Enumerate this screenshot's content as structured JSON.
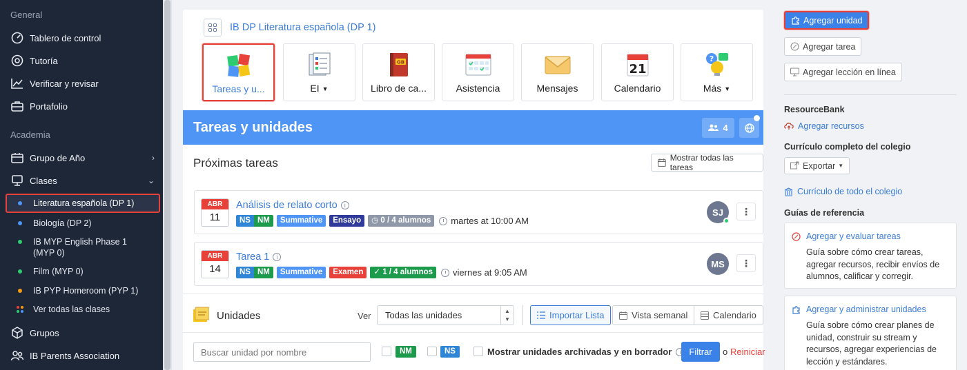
{
  "sidebar": {
    "sections": {
      "general": "General",
      "academia": "Academia"
    },
    "items": {
      "tablero": "Tablero de control",
      "tutoria": "Tutoría",
      "verificar": "Verificar y revisar",
      "portafolio": "Portafolio",
      "grupo_anio": "Grupo de Año",
      "clases": "Clases",
      "grupos": "Grupos",
      "ib_parents": "IB Parents Association"
    },
    "classes": [
      {
        "label": "Literatura española (DP 1)",
        "color": "#4e95f6"
      },
      {
        "label": "Biología (DP 2)",
        "color": "#4e95f6"
      },
      {
        "label": "IB MYP English Phase 1 (MYP 0)",
        "color": "#2ecc71"
      },
      {
        "label": "Film (MYP 0)",
        "color": "#2ecc71"
      },
      {
        "label": "IB PYP Homeroom (PYP 1)",
        "color": "#f39c12"
      }
    ],
    "all_classes": "Ver todas las clases"
  },
  "class_card": {
    "title": "IB DP Literatura española (DP 1)",
    "tools": [
      {
        "label": "Tareas y u...",
        "icon": "puzzle-icon"
      },
      {
        "label": "EI",
        "icon": "checklist-icon"
      },
      {
        "label": "Libro de ca...",
        "icon": "gradebook-icon"
      },
      {
        "label": "Asistencia",
        "icon": "attendance-icon"
      },
      {
        "label": "Mensajes",
        "icon": "envelope-icon"
      },
      {
        "label": "Calendario",
        "icon": "calendar-icon",
        "day": "21"
      },
      {
        "label": "Más",
        "icon": "more-apps-icon"
      }
    ]
  },
  "banner": {
    "title": "Tareas y unidades",
    "members_count": "4"
  },
  "upcoming": {
    "title": "Próximas tareas",
    "show_all": "Mostrar todas las tareas",
    "tasks": [
      {
        "month": "ABR",
        "day": "11",
        "name": "Análisis de relato corto",
        "ns": "NS",
        "nm": "NM",
        "type": "Summative",
        "kind": "Ensayo",
        "students": "0 / 4 alumnos",
        "time": "martes at 10:00 AM",
        "avatar": "SJ"
      },
      {
        "month": "ABR",
        "day": "14",
        "name": "Tarea 1",
        "ns": "NS",
        "nm": "NM",
        "type": "Summative",
        "kind": "Examen",
        "students": "1 / 4 alumnos",
        "time": "viernes at 9:05 AM",
        "avatar": "MS"
      }
    ]
  },
  "units": {
    "title": "Unidades",
    "ver": "Ver",
    "select_value": "Todas las unidades",
    "import_list": "Importar Lista",
    "weekly": "Vista semanal",
    "calendar": "Calendario",
    "search_placeholder": "Buscar unidad por nombre",
    "tag_nm": "NM",
    "tag_ns": "NS",
    "show_archived": "Mostrar unidades archivadas y en borrador",
    "filter": "Filtrar",
    "or": "o",
    "reset": "Reiniciar"
  },
  "right": {
    "add_unit": "Agregar unidad",
    "add_task": "Agregar tarea",
    "add_online": "Agregar lección en línea",
    "resourcebank": "ResourceBank",
    "add_resources": "Agregar recursos",
    "curriculum_head": "Currículo completo del colegio",
    "export": "Exportar",
    "school_curriculum": "Currículo de todo el colegio",
    "guides_head": "Guías de referencia",
    "guides": [
      {
        "title": "Agregar y evaluar tareas",
        "desc": "Guía sobre cómo crear tareas, agregar recursos, recibir envíos de alumnos, calificar y corregir."
      },
      {
        "title": "Agregar y administrar unidades",
        "desc": "Guía sobre cómo crear planes de unidad, construir su stream y recursos, agregar experiencias de lección y estándares."
      }
    ]
  }
}
